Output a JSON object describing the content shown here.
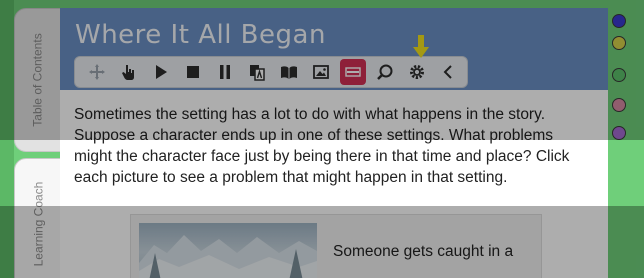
{
  "sidebar": {
    "tabs": [
      {
        "label": "Table of Contents"
      },
      {
        "label": "Learning Coach"
      }
    ]
  },
  "header": {
    "title": "Where It All Began"
  },
  "toolbar": {
    "tools": [
      "move-icon",
      "hand-pointer-icon",
      "play-icon",
      "stop-icon",
      "pause-icon",
      "translate-icon",
      "book-icon",
      "image-icon",
      "highlight-mask-icon",
      "zoom-icon",
      "gear-icon",
      "chevron-left-icon"
    ],
    "active_tool": "highlight-mask-icon",
    "active_color": "#d13054"
  },
  "main": {
    "paragraph": "Sometimes the setting has a lot to do with what happens in the story. Suppose a character ends up in one of these settings. What problems might the character face just by being there in that time and place? Click each picture to see a problem that might happen in that setting.",
    "caption": "Someone gets caught in a"
  },
  "right_nav": {
    "dots": [
      "#3a3ad0",
      "#d8d24a",
      "#5cc06a",
      "#d68aa2",
      "#a46ad2"
    ]
  },
  "colors": {
    "header": "#6a90c4",
    "frame": "#6fcf7a",
    "pointer": "#f2e21c"
  }
}
